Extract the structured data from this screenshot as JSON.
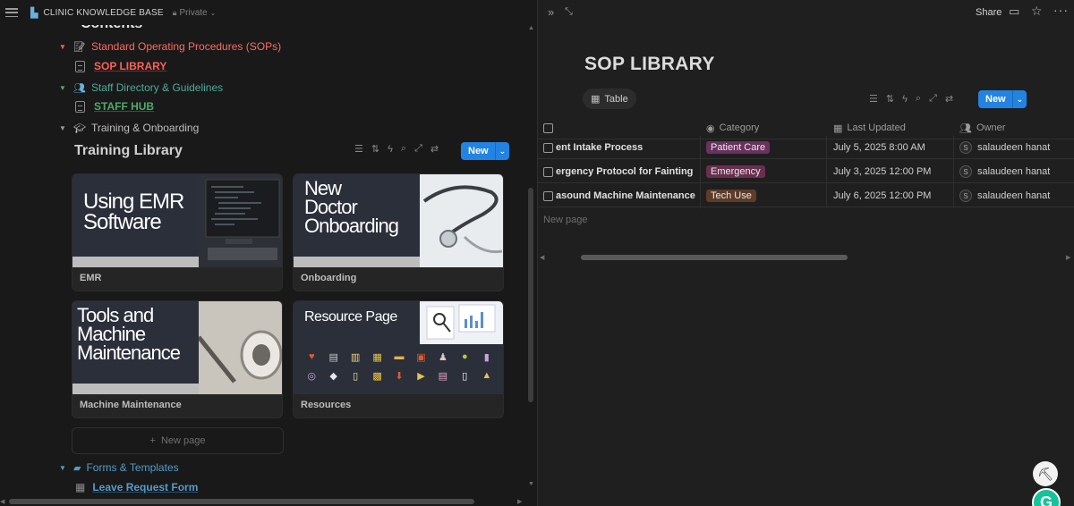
{
  "workspace": {
    "title": "CLINIC KNOWLEDGE BASE",
    "privacy": "Private"
  },
  "contents_heading": "Contents",
  "tree": {
    "sops": {
      "label": "Standard Operating Procedures (SOPs)",
      "child": "SOP LIBRARY",
      "color": "#ff5f57"
    },
    "staff": {
      "label": "Staff Directory & Guidelines",
      "child": "STAFF HUB",
      "color": "#4dab6b"
    },
    "training": {
      "label": "Training & Onboarding"
    },
    "forms": {
      "label": "Forms & Templates",
      "child": "Leave Request Form",
      "color": "#529cca"
    }
  },
  "training_library": {
    "title": "Training Library",
    "new_label": "New",
    "new_page_label": "New page",
    "cards": [
      {
        "cover": [
          "Using EMR",
          "Software"
        ],
        "caption": "EMR"
      },
      {
        "cover": [
          "New",
          "Doctor",
          "Onboarding"
        ],
        "caption": "Onboarding"
      },
      {
        "cover": [
          "Tools and",
          "Machine",
          "Maintenance"
        ],
        "caption": "Machine Maintenance"
      },
      {
        "cover": [
          "Resource Page"
        ],
        "caption": "Resources"
      }
    ]
  },
  "right_header": {
    "share": "Share"
  },
  "sop_library": {
    "title": "SOP LIBRARY",
    "view_tab": "Table",
    "new_label": "New",
    "new_page_label": "New page",
    "columns": {
      "name": "",
      "category": "Category",
      "updated": "Last Updated",
      "owner": "Owner"
    },
    "rows": [
      {
        "name": "ent Intake Process",
        "category": "Patient Care",
        "category_color": "#6c3b63",
        "updated": "July 5, 2025 8:00 AM",
        "owner": "salaudeen hanat",
        "owner_initial": "S"
      },
      {
        "name": "ergency Protocol for Fainting",
        "category": "Emergency",
        "category_color": "#6c3b5a",
        "updated": "July 3, 2025 12:00 PM",
        "owner": "salaudeen hanat",
        "owner_initial": "S"
      },
      {
        "name": "asound Machine Maintenance",
        "category": "Tech Use",
        "category_color": "#6b4530",
        "updated": "July 6, 2025 12:00 PM",
        "owner": "salaudeen hanat",
        "owner_initial": "S"
      }
    ]
  },
  "icons": {
    "menu": "hamburger-icon",
    "workspace": "building-icon",
    "lock": "lock-icon",
    "collapse": "double-chevron-icon",
    "expand": "expand-icon",
    "comment": "comment-icon",
    "star": "star-icon",
    "more": "more-icon",
    "grammarly": "grammarly-icon",
    "help": "help-icon"
  }
}
